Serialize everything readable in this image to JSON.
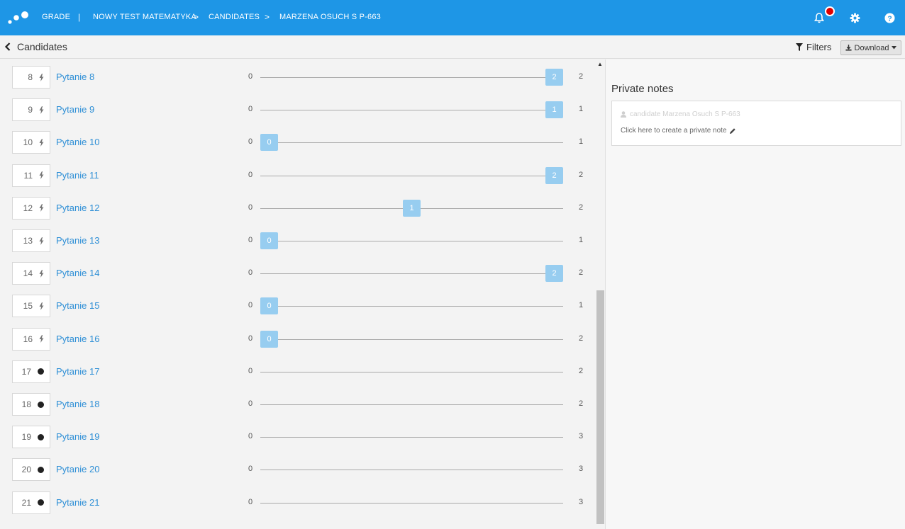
{
  "header": {
    "crumbs": [
      "GRADE",
      "NOWY TEST MATEMATYKA",
      "CANDIDATES",
      "MARZENA OSUCH S P-663"
    ],
    "first_separator": "|",
    "separator": ">",
    "accent_color": "#1e96e6",
    "badge_color": "#e00000"
  },
  "subbar": {
    "back_label": "Candidates",
    "filters_label": "Filters",
    "download_label": "Download"
  },
  "questions": [
    {
      "num": "8",
      "icon": "lightning-icon",
      "name": "Pytanie 8",
      "min": "0",
      "max": "2",
      "score": "2",
      "fraction": 1
    },
    {
      "num": "9",
      "icon": "lightning-icon",
      "name": "Pytanie 9",
      "min": "0",
      "max": "1",
      "score": "1",
      "fraction": 1
    },
    {
      "num": "10",
      "icon": "lightning-icon",
      "name": "Pytanie 10",
      "min": "0",
      "max": "1",
      "score": "0",
      "fraction": 0
    },
    {
      "num": "11",
      "icon": "lightning-icon",
      "name": "Pytanie 11",
      "min": "0",
      "max": "2",
      "score": "2",
      "fraction": 1
    },
    {
      "num": "12",
      "icon": "lightning-icon",
      "name": "Pytanie 12",
      "min": "0",
      "max": "2",
      "score": "1",
      "fraction": 0.5
    },
    {
      "num": "13",
      "icon": "lightning-icon",
      "name": "Pytanie 13",
      "min": "0",
      "max": "1",
      "score": "0",
      "fraction": 0
    },
    {
      "num": "14",
      "icon": "lightning-icon",
      "name": "Pytanie 14",
      "min": "0",
      "max": "2",
      "score": "2",
      "fraction": 1
    },
    {
      "num": "15",
      "icon": "lightning-icon",
      "name": "Pytanie 15",
      "min": "0",
      "max": "1",
      "score": "0",
      "fraction": 0
    },
    {
      "num": "16",
      "icon": "lightning-icon",
      "name": "Pytanie 16",
      "min": "0",
      "max": "2",
      "score": "0",
      "fraction": 0
    },
    {
      "num": "17",
      "icon": "dot-icon",
      "name": "Pytanie 17",
      "min": "0",
      "max": "2",
      "score": null,
      "fraction": null
    },
    {
      "num": "18",
      "icon": "dot-icon",
      "name": "Pytanie 18",
      "min": "0",
      "max": "2",
      "score": null,
      "fraction": null
    },
    {
      "num": "19",
      "icon": "dot-icon",
      "name": "Pytanie 19",
      "min": "0",
      "max": "3",
      "score": null,
      "fraction": null
    },
    {
      "num": "20",
      "icon": "dot-icon",
      "name": "Pytanie 20",
      "min": "0",
      "max": "3",
      "score": null,
      "fraction": null
    },
    {
      "num": "21",
      "icon": "dot-icon",
      "name": "Pytanie 21",
      "min": "0",
      "max": "3",
      "score": null,
      "fraction": null
    }
  ],
  "private_notes": {
    "title": "Private notes",
    "candidate_line": "candidate Marzena Osuch S P-663",
    "create_label": "Click here to create a private note"
  }
}
